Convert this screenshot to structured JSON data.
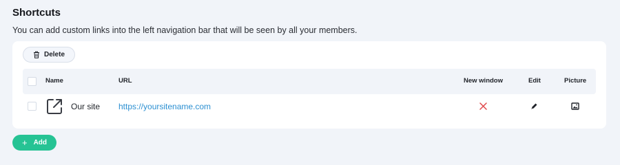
{
  "header": {
    "title": "Shortcuts",
    "description": "You can add custom links into the left navigation bar that will be seen by all your members."
  },
  "toolbar": {
    "delete_label": "Delete"
  },
  "table": {
    "columns": [
      "Name",
      "URL",
      "New window",
      "Edit",
      "Picture"
    ],
    "rows": [
      {
        "name": "Our site",
        "url": "https://yoursitename.com",
        "icon": "external-link-icon",
        "new_window": false
      }
    ]
  },
  "footer": {
    "add_label": "Add"
  },
  "colors": {
    "accent": "#26c394",
    "link": "#2b8fd1",
    "danger": "#e0484a"
  }
}
